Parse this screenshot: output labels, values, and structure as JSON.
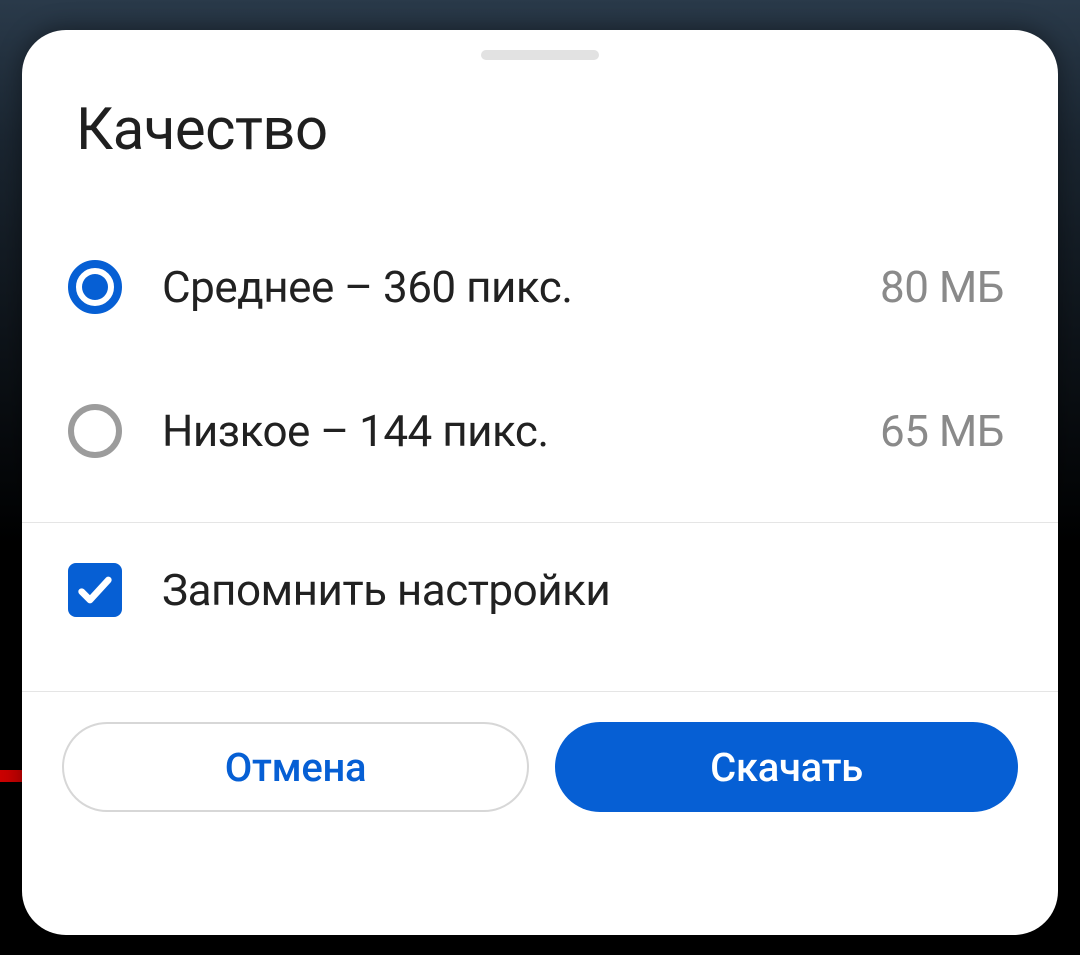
{
  "colors": {
    "accent": "#065fd4"
  },
  "sheet": {
    "title": "Качество",
    "options": [
      {
        "label": "Среднее – 360 пикс.",
        "size": "80 МБ",
        "selected": true
      },
      {
        "label": "Низкое – 144 пикс.",
        "size": "65 МБ",
        "selected": false
      }
    ],
    "remember": {
      "label": "Запомнить настройки",
      "checked": true
    },
    "actions": {
      "cancel": "Отмена",
      "download": "Скачать"
    }
  }
}
